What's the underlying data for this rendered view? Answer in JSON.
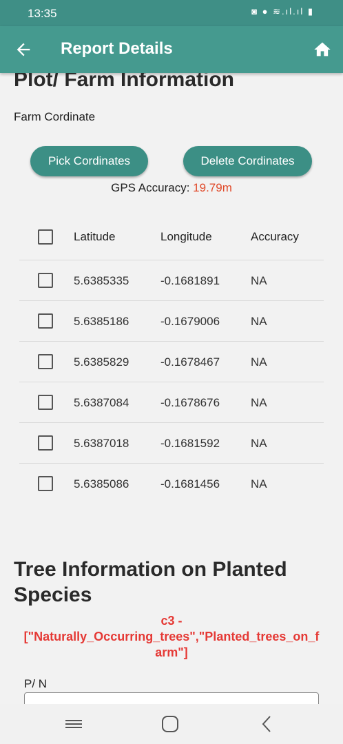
{
  "status_bar": {
    "time": "13:35",
    "icons": "◙ ● ≋.ıl.ıl ▮"
  },
  "app_bar": {
    "title": "Report Details",
    "back_icon": "arrow-left",
    "home_icon": "home"
  },
  "plot_section": {
    "title": "Plot/ Farm Information",
    "farm_coordinate_label": "Farm Cordinate",
    "pick_button": "Pick Cordinates",
    "delete_button": "Delete Cordinates",
    "gps_accuracy_label": "GPS Accuracy:",
    "gps_accuracy_value": "19.79m"
  },
  "table": {
    "columns": [
      "Latitude",
      "Longitude",
      "Accuracy"
    ],
    "rows": [
      {
        "lat": "5.6385335",
        "lon": "-0.1681891",
        "acc": "NA"
      },
      {
        "lat": "5.6385186",
        "lon": "-0.1679006",
        "acc": "NA"
      },
      {
        "lat": "5.6385829",
        "lon": "-0.1678467",
        "acc": "NA"
      },
      {
        "lat": "5.6387084",
        "lon": "-0.1678676",
        "acc": "NA"
      },
      {
        "lat": "5.6387018",
        "lon": "-0.1681592",
        "acc": "NA"
      },
      {
        "lat": "5.6385086",
        "lon": "-0.1681456",
        "acc": "NA"
      }
    ]
  },
  "tree_section": {
    "title_line1": "Tree Information on Planted",
    "title_line2": "Species",
    "note_line1": "c3 -",
    "note_line2": "[\"Naturally_Occurring_trees\",\"Planted_trees_on_f",
    "note_line3": "arm\"]",
    "pn_label": "P/ N"
  },
  "colors": {
    "primary": "#459a8f",
    "button": "#3c8f85",
    "accent_red": "#e53935",
    "gps_value": "#e04a2a"
  },
  "nav_bar": {
    "icons": [
      "recent-apps",
      "home",
      "back"
    ]
  }
}
